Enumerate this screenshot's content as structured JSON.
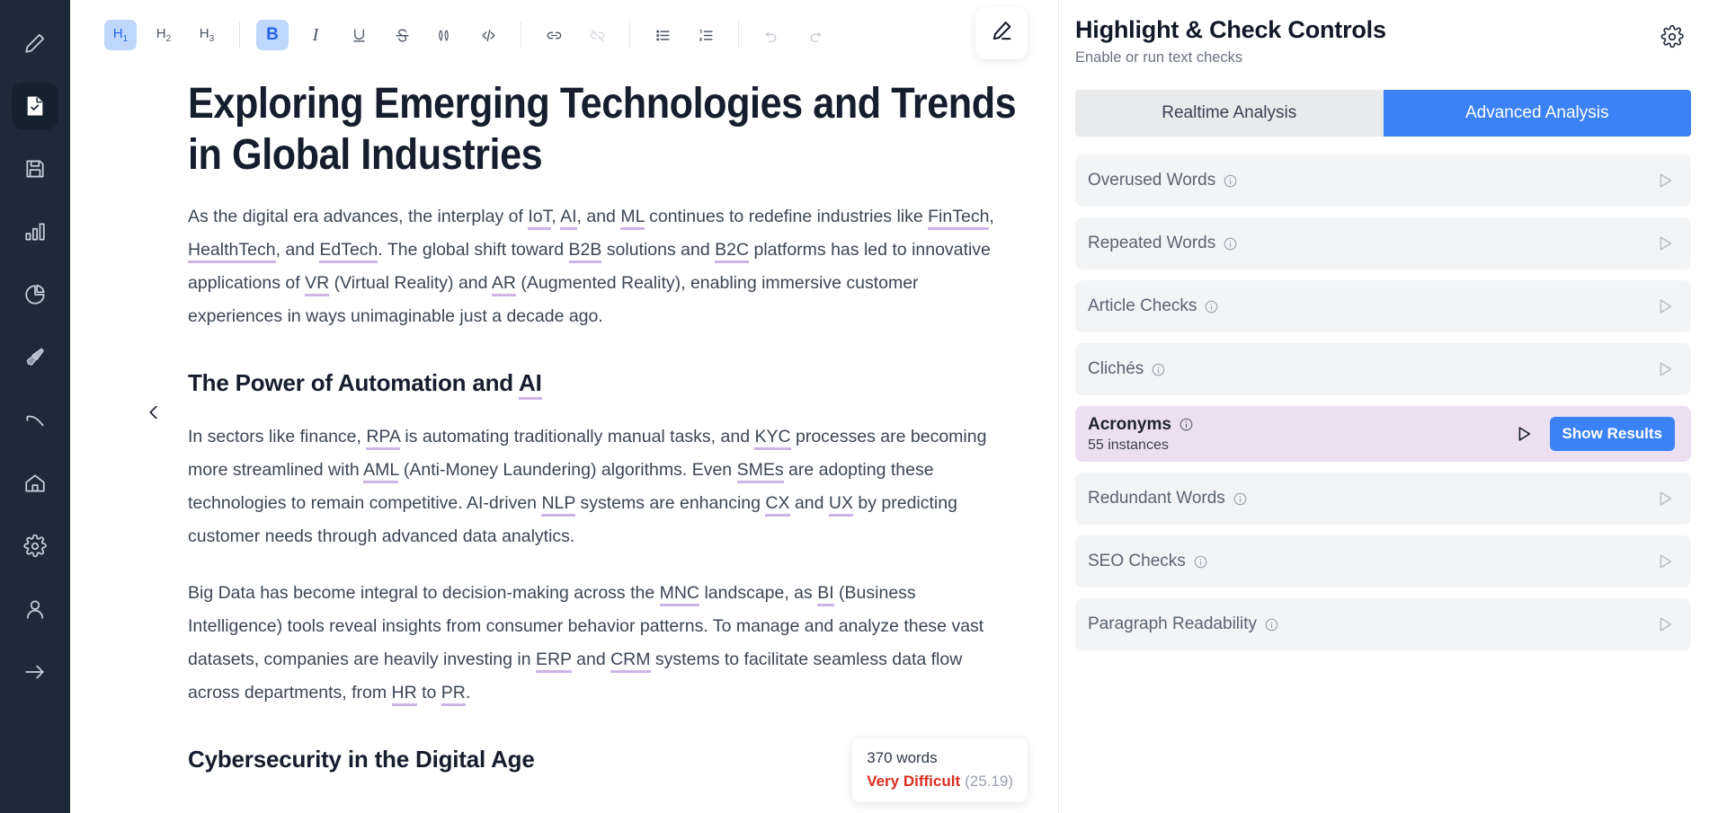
{
  "rail": {
    "items": [
      {
        "name": "pen-icon",
        "label": "Write",
        "active": false
      },
      {
        "name": "document-check-icon",
        "label": "Document",
        "active": true
      },
      {
        "name": "save-icon",
        "label": "Save",
        "active": false
      },
      {
        "name": "bar-chart-icon",
        "label": "Statistics",
        "active": false
      },
      {
        "name": "pie-chart-icon",
        "label": "Analytics",
        "active": false
      },
      {
        "name": "highlighter-icon",
        "label": "Highlight",
        "active": false
      },
      {
        "name": "curve-icon",
        "label": "Curve",
        "active": false
      },
      {
        "name": "home-icon",
        "label": "Home",
        "active": false
      },
      {
        "name": "gear-icon",
        "label": "Settings",
        "active": false
      },
      {
        "name": "user-icon",
        "label": "Account",
        "active": false
      },
      {
        "name": "arrow-right-icon",
        "label": "Collapse",
        "active": false
      }
    ]
  },
  "toolbar": {
    "groups": [
      [
        {
          "name": "heading-1-button",
          "label": "H",
          "sub": "1",
          "kind": "text",
          "state": "active"
        },
        {
          "name": "heading-2-button",
          "label": "H",
          "sub": "2",
          "kind": "text",
          "state": "normal"
        },
        {
          "name": "heading-3-button",
          "label": "H",
          "sub": "3",
          "kind": "text",
          "state": "normal"
        }
      ],
      [
        {
          "name": "bold-button",
          "label": "B",
          "kind": "bold",
          "state": "active"
        },
        {
          "name": "italic-button",
          "label": "I",
          "kind": "italic",
          "state": "normal"
        },
        {
          "name": "underline-button",
          "label": "U",
          "kind": "underline",
          "state": "normal"
        },
        {
          "name": "strikethrough-button",
          "label": "S",
          "kind": "strike",
          "state": "normal"
        },
        {
          "name": "blockquote-button",
          "label": "””",
          "kind": "quote",
          "state": "normal"
        },
        {
          "name": "code-block-button",
          "label": "</>",
          "kind": "code",
          "state": "normal"
        }
      ],
      [
        {
          "name": "link-button",
          "kind": "link",
          "state": "normal"
        },
        {
          "name": "unlink-button",
          "kind": "unlink",
          "state": "disabled"
        }
      ],
      [
        {
          "name": "bullet-list-button",
          "kind": "ul",
          "state": "normal"
        },
        {
          "name": "ordered-list-button",
          "kind": "ol",
          "state": "normal"
        }
      ],
      [
        {
          "name": "undo-button",
          "kind": "undo",
          "state": "disabled"
        },
        {
          "name": "redo-button",
          "kind": "redo",
          "state": "disabled"
        }
      ]
    ]
  },
  "document": {
    "title_line1": "Exploring Emerging Technologies and Trends",
    "title_line2": "in Global Industries",
    "paragraph1": {
      "t1": "As the digital era advances, the interplay of ",
      "a1": "IoT",
      "t2": ", ",
      "a2": "AI",
      "t3": ", and ",
      "a3": "ML",
      "t4": " continues to redefine industries like ",
      "a4": "FinTech",
      "t5": ", ",
      "a5": "HealthTech",
      "t6": ", and ",
      "a6": "EdTech",
      "t7": ". The global shift toward ",
      "a7": "B2B",
      "t8": " solutions and ",
      "a8": "B2C",
      "t9": " platforms has led to innovative applications of ",
      "a9": "VR",
      "t10": " (Virtual Reality) and ",
      "a10": "AR",
      "t11": " (Augmented Reality), enabling immersive customer experiences in ways unimaginable just a decade ago."
    },
    "heading1": {
      "pre": "The Power of Automation and ",
      "acr": "AI"
    },
    "paragraph2": {
      "t1": "In sectors like finance, ",
      "a1": "RPA",
      "t2": " is automating traditionally manual tasks, and ",
      "a2": "KYC",
      "t3": " processes are becoming more streamlined with ",
      "a3": "AML",
      "t4": " (Anti-Money Laundering) algorithms. Even ",
      "a4": "SMEs",
      "t5": " are adopting these technologies to remain competitive. AI-driven ",
      "a5": "NLP",
      "t6": " systems are enhancing ",
      "a6": "CX",
      "t7": " and ",
      "a7": "UX",
      "t8": " by predicting customer needs through advanced data analytics."
    },
    "paragraph3": {
      "t1": "Big Data has become integral to decision-making across the ",
      "a1": "MNC",
      "t2": " landscape, as ",
      "a2": "BI",
      "t3": " (Business Intelligence) tools reveal insights from consumer behavior patterns. To manage and analyze these vast datasets, companies are heavily investing in ",
      "a3": "ERP",
      "t4": " and ",
      "a4": "CRM",
      "t5": " systems to facilitate seamless data flow across departments, from ",
      "a5": "HR",
      "t6": " to ",
      "a6": "PR",
      "t7": "."
    },
    "heading2": "Cybersecurity in the Digital Age",
    "nav": {
      "prev_icon": "chevron-left-icon",
      "next_icon": "chevron-right-icon"
    },
    "edit_icon": "pencil-icon"
  },
  "word_count": {
    "words": "370 words",
    "difficulty": "Very Difficult",
    "score": "(25.19)",
    "difficulty_color": "#d92d20"
  },
  "panel": {
    "title": "Highlight & Check Controls",
    "subtitle": "Enable or run text checks",
    "settings_icon": "gear-icon",
    "tabs": [
      {
        "label": "Realtime Analysis",
        "active": false
      },
      {
        "label": "Advanced Analysis",
        "active": true
      }
    ],
    "accent_color": "#3b82f6",
    "highlight_color": "#ecdff2",
    "checks": [
      {
        "label": "Overused Words",
        "count": "",
        "highlighted": false,
        "action": ""
      },
      {
        "label": "Repeated Words",
        "count": "",
        "highlighted": false,
        "action": ""
      },
      {
        "label": "Article Checks",
        "count": "",
        "highlighted": false,
        "action": ""
      },
      {
        "label": "Clichés",
        "count": "",
        "highlighted": false,
        "action": ""
      },
      {
        "label": "Acronyms",
        "count": "55 instances",
        "highlighted": true,
        "action": "Show Results"
      },
      {
        "label": "Redundant Words",
        "count": "",
        "highlighted": false,
        "action": ""
      },
      {
        "label": "SEO Checks",
        "count": "",
        "highlighted": false,
        "action": ""
      },
      {
        "label": "Paragraph Readability",
        "count": "",
        "highlighted": false,
        "action": ""
      }
    ]
  }
}
